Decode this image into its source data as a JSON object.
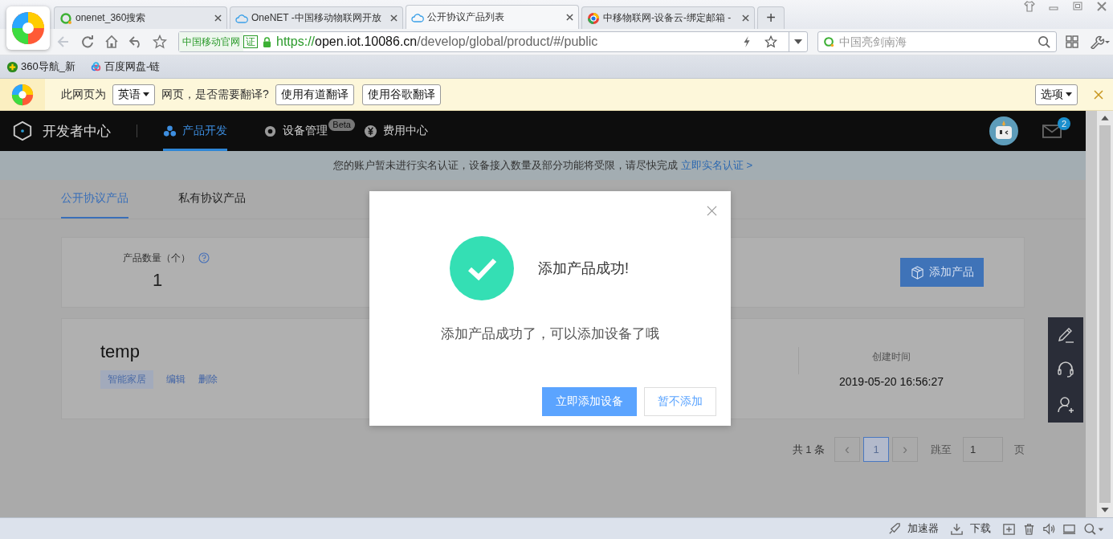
{
  "browser": {
    "tabs": [
      {
        "label": "onenet_360搜索",
        "selected": false
      },
      {
        "label": "OneNET -中国移动物联网开放",
        "selected": false
      },
      {
        "label": "公开协议产品列表",
        "selected": true
      },
      {
        "label": "中移物联网-设备云-绑定邮箱 -",
        "selected": false
      }
    ],
    "new_tab": "+",
    "address": {
      "badge": "中国移动官网",
      "cert": "证",
      "scheme": "https://",
      "host": "open.iot.10086.cn",
      "path": "/develop/global/product/#/public"
    },
    "search": {
      "placeholder": "中国亮剑南海"
    },
    "bookmarks": [
      "360导航_新",
      "百度网盘-链"
    ]
  },
  "translate_bar": {
    "prefix": "此网页为",
    "language": "英语",
    "question": "网页，是否需要翻译?",
    "buttons": [
      "使用有道翻译",
      "使用谷歌翻译"
    ],
    "options": "选项"
  },
  "navbar": {
    "brand": "开发者中心",
    "items": [
      {
        "label": "产品开发",
        "selected": true
      },
      {
        "label": "设备管理",
        "selected": false,
        "badge": "Beta"
      },
      {
        "label": "费用中心",
        "selected": false
      }
    ],
    "mail_count": "2"
  },
  "notice": {
    "text": "您的账户暂未进行实名认证，设备接入数量及部分功能将受限，请尽快完成",
    "link": "立即实名认证 >"
  },
  "subtabs": [
    {
      "label": "公开协议产品",
      "selected": true
    },
    {
      "label": "私有协议产品",
      "selected": false
    }
  ],
  "summary": {
    "label": "产品数量（个）",
    "value": "1",
    "add_button": "添加产品"
  },
  "product": {
    "name": "temp",
    "tag": "智能家居",
    "actions": [
      "编辑",
      "删除"
    ],
    "created_label": "创建时间",
    "created": "2019-05-20 16:56:27"
  },
  "pagination": {
    "total": "共 1 条",
    "prev": "‹",
    "next": "›",
    "pages": [
      {
        "label": "1",
        "selected": true
      }
    ],
    "jump_label": "跳至",
    "jump_value": "1",
    "unit": "页"
  },
  "dialog": {
    "title": "添加产品成功!",
    "message": "添加产品成功了，可以添加设备了哦",
    "buttons": [
      {
        "label": "立即添加设备",
        "kind": "primary"
      },
      {
        "label": "暂不添加",
        "kind": "secondary"
      }
    ]
  },
  "status_bar": {
    "items": [
      "加速器",
      "下载"
    ]
  }
}
